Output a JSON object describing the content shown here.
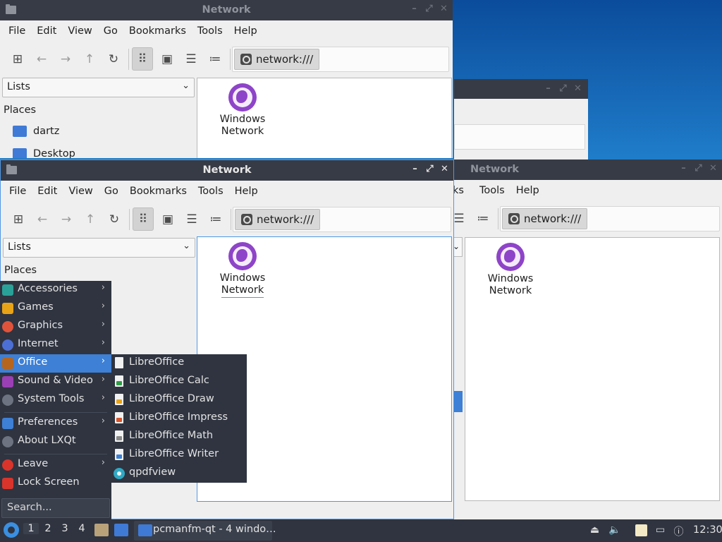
{
  "windows": {
    "top": {
      "title": "Network",
      "menus": [
        "File",
        "Edit",
        "View",
        "Go",
        "Bookmarks",
        "Tools",
        "Help"
      ],
      "path": "network:///",
      "combo": "Lists",
      "places_header": "Places",
      "places": [
        "dartz",
        "Desktop"
      ],
      "item_label_1": "Windows",
      "item_label_2": "Network"
    },
    "main": {
      "title": "Network",
      "menus": [
        "File",
        "Edit",
        "View",
        "Go",
        "Bookmarks",
        "Tools",
        "Help"
      ],
      "path": "network:///",
      "combo": "Lists",
      "places_header": "Places",
      "item_label_1": "Windows",
      "item_label_2": "Network"
    },
    "right": {
      "title": "Network",
      "menus_visible": [
        "ks",
        "Tools",
        "Help"
      ],
      "path": "network:///",
      "item_label_1": "Windows",
      "item_label_2": "Network"
    },
    "back": {
      "buttons": [
        "–",
        "⤢",
        "✕"
      ]
    },
    "buttons": [
      "–",
      "⤢",
      "✕"
    ]
  },
  "start_menu": {
    "items": [
      {
        "label": "Accessories",
        "icon": "accessories-icon",
        "color": "#2aa198"
      },
      {
        "label": "Games",
        "icon": "games-icon",
        "color": "#e8a317"
      },
      {
        "label": "Graphics",
        "icon": "graphics-icon",
        "color": "#e0533b"
      },
      {
        "label": "Internet",
        "icon": "internet-icon",
        "color": "#4c6fd6"
      },
      {
        "label": "Office",
        "icon": "office-icon",
        "color": "#b5651d"
      },
      {
        "label": "Sound & Video",
        "icon": "sound-video-icon",
        "color": "#9b3fb5"
      },
      {
        "label": "System Tools",
        "icon": "system-tools-icon",
        "color": "#6d7380"
      }
    ],
    "items2": [
      {
        "label": "Preferences",
        "icon": "preferences-icon",
        "color": "#3d80d6"
      },
      {
        "label": "About LXQt",
        "icon": "about-icon",
        "color": "#6d7380"
      }
    ],
    "items3": [
      {
        "label": "Leave",
        "icon": "leave-icon",
        "color": "#d9342b"
      },
      {
        "label": "Lock Screen",
        "icon": "lock-icon",
        "color": "#d9342b"
      }
    ],
    "search_placeholder": "Search...",
    "arrow": "›"
  },
  "office_submenu": {
    "items": [
      {
        "label": "LibreOffice",
        "accent": "#ffffff"
      },
      {
        "label": "LibreOffice Calc",
        "accent": "#2e9e45"
      },
      {
        "label": "LibreOffice Draw",
        "accent": "#e8a317"
      },
      {
        "label": "LibreOffice Impress",
        "accent": "#d9542b"
      },
      {
        "label": "LibreOffice Math",
        "accent": "#8a8a8a"
      },
      {
        "label": "LibreOffice Writer",
        "accent": "#3d80d6"
      }
    ],
    "viewer": "qpdfview"
  },
  "taskbar": {
    "workspaces": [
      "1",
      "2",
      "3",
      "4"
    ],
    "task_label": "pcmanfm-qt - 4 windo…",
    "clock": "12:30"
  }
}
